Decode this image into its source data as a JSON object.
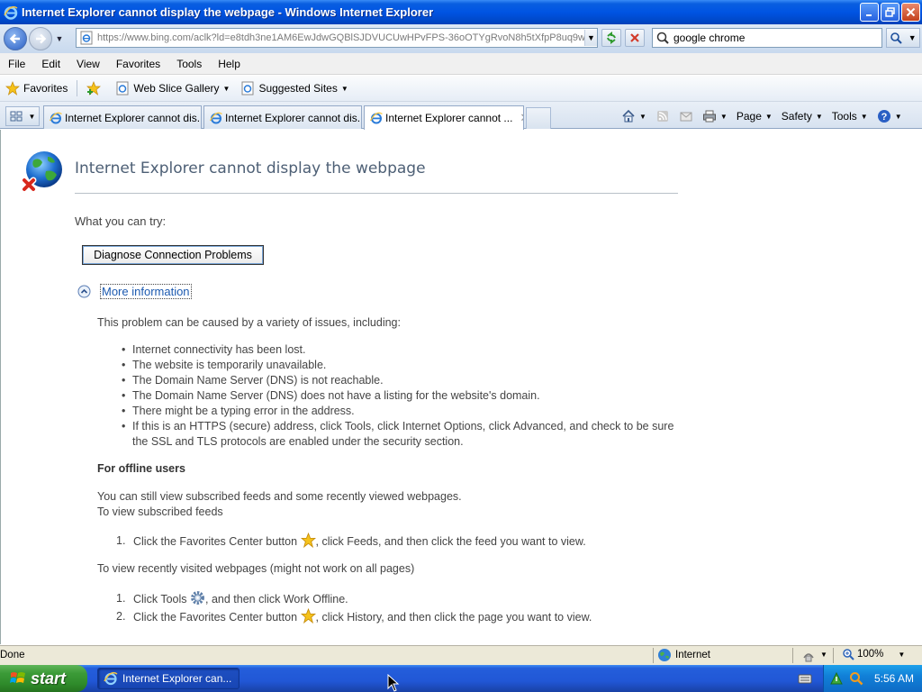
{
  "window": {
    "title": "Internet Explorer cannot display the webpage - Windows Internet Explorer",
    "buttons": [
      "minimize-icon",
      "restore-icon",
      "close-icon"
    ]
  },
  "address_bar": {
    "url": "https://www.bing.com/aclk?ld=e8tdh3ne1AM6EwJdwGQBlSJDVUCUwHPvFPS-36oOTYgRvoN8h5tXfpP8uq9wyx_",
    "search_value": "google chrome"
  },
  "menu": [
    "File",
    "Edit",
    "View",
    "Favorites",
    "Tools",
    "Help"
  ],
  "favorites_bar": {
    "favorites_label": "Favorites",
    "web_slice_gallery": "Web Slice Gallery",
    "suggested_sites": "Suggested Sites"
  },
  "tabs": [
    {
      "label": "Internet Explorer cannot dis...",
      "active": false
    },
    {
      "label": "Internet Explorer cannot dis...",
      "active": false
    },
    {
      "label": "Internet Explorer cannot ...",
      "active": true
    }
  ],
  "command_bar": {
    "page": "Page",
    "safety": "Safety",
    "tools": "Tools"
  },
  "content": {
    "title": "Internet Explorer cannot display the webpage",
    "what_you_can_try": "What you can try:",
    "diagnose_button": "Diagnose Connection Problems",
    "more_information": "More information",
    "problem_intro": "This problem can be caused by a variety of issues, including:",
    "causes": [
      "Internet connectivity has been lost.",
      "The website is temporarily unavailable.",
      "The Domain Name Server (DNS) is not reachable.",
      "The Domain Name Server (DNS) does not have a listing for the website's domain.",
      "There might be a typing error in the address.",
      "If this is an HTTPS (secure) address, click Tools, click Internet Options, click Advanced, and check to be sure the SSL and TLS protocols are enabled under the security section."
    ],
    "offline_heading": "For offline users",
    "offline_line1": "You can still view subscribed feeds and some recently viewed webpages.",
    "offline_line2": "To view subscribed feeds",
    "feeds_step_num": "1.",
    "feeds_step_a": "Click the Favorites Center button",
    "feeds_step_b": ", click Feeds, and then click the feed you want to view.",
    "recent_intro": "To view recently visited webpages (might not work on all pages)",
    "recent_steps": [
      {
        "num": "1.",
        "a": "Click Tools",
        "b": ", and then click Work Offline."
      },
      {
        "num": "2.",
        "a": "Click the Favorites Center button",
        "b": ", click History, and then click the page you want to view."
      }
    ]
  },
  "status_bar": {
    "status": "Done",
    "zone": "Internet",
    "zoom": "100%"
  },
  "taskbar": {
    "start": "start",
    "task_item": "Internet Explorer can...",
    "clock": "5:56 AM"
  },
  "colors": {
    "title_bar": "#0054e3",
    "link": "#1c5ab0",
    "heading": "#4d5f75",
    "taskbar": "#245edb",
    "start_button": "#3c9b38"
  }
}
